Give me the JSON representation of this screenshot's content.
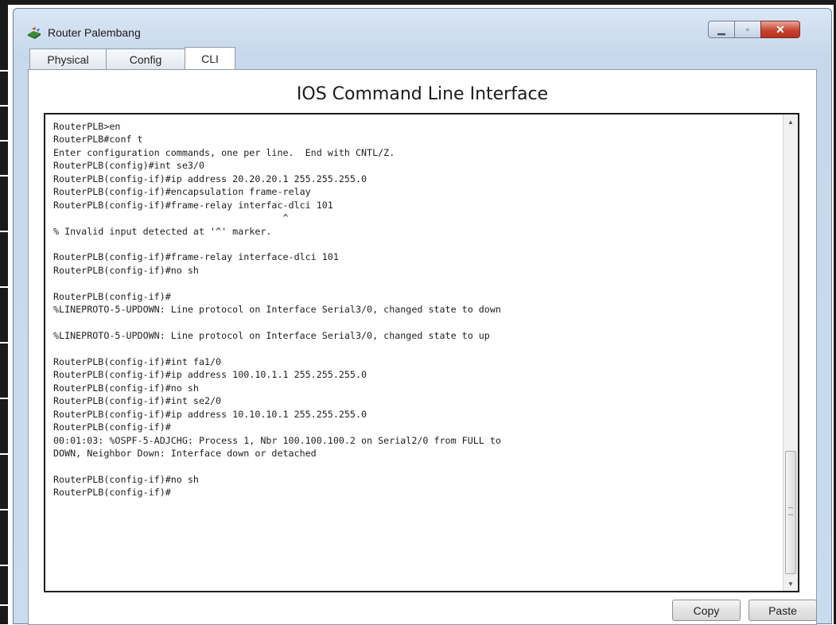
{
  "window": {
    "title": "Router Palembang",
    "icon": "router-icon",
    "controls": {
      "minimize": "minimize-icon",
      "maximize": "maximize-icon",
      "close": "close-icon"
    }
  },
  "tabs": [
    {
      "label": "Physical",
      "selected": false
    },
    {
      "label": "Config",
      "selected": false
    },
    {
      "label": "CLI",
      "selected": true
    }
  ],
  "cli": {
    "heading": "IOS Command Line Interface",
    "lines": [
      "RouterPLB>en",
      "RouterPLB#conf t",
      "Enter configuration commands, one per line.  End with CNTL/Z.",
      "RouterPLB(config)#int se3/0",
      "RouterPLB(config-if)#ip address 20.20.20.1 255.255.255.0",
      "RouterPLB(config-if)#encapsulation frame-relay",
      "RouterPLB(config-if)#frame-relay interfac-dlci 101",
      "                                         ^",
      "% Invalid input detected at '^' marker.",
      "",
      "RouterPLB(config-if)#frame-relay interface-dlci 101",
      "RouterPLB(config-if)#no sh",
      "",
      "RouterPLB(config-if)#",
      "%LINEPROTO-5-UPDOWN: Line protocol on Interface Serial3/0, changed state to down",
      "",
      "%LINEPROTO-5-UPDOWN: Line protocol on Interface Serial3/0, changed state to up",
      "",
      "RouterPLB(config-if)#int fa1/0",
      "RouterPLB(config-if)#ip address 100.10.1.1 255.255.255.0",
      "RouterPLB(config-if)#no sh",
      "RouterPLB(config-if)#int se2/0",
      "RouterPLB(config-if)#ip address 10.10.10.1 255.255.255.0",
      "RouterPLB(config-if)#",
      "00:01:03: %OSPF-5-ADJCHG: Process 1, Nbr 100.100.100.2 on Serial2/0 from FULL to",
      "DOWN, Neighbor Down: Interface down or detached",
      "",
      "RouterPLB(config-if)#no sh",
      "RouterPLB(config-if)#"
    ]
  },
  "buttons": {
    "copy": "Copy",
    "paste": "Paste"
  }
}
